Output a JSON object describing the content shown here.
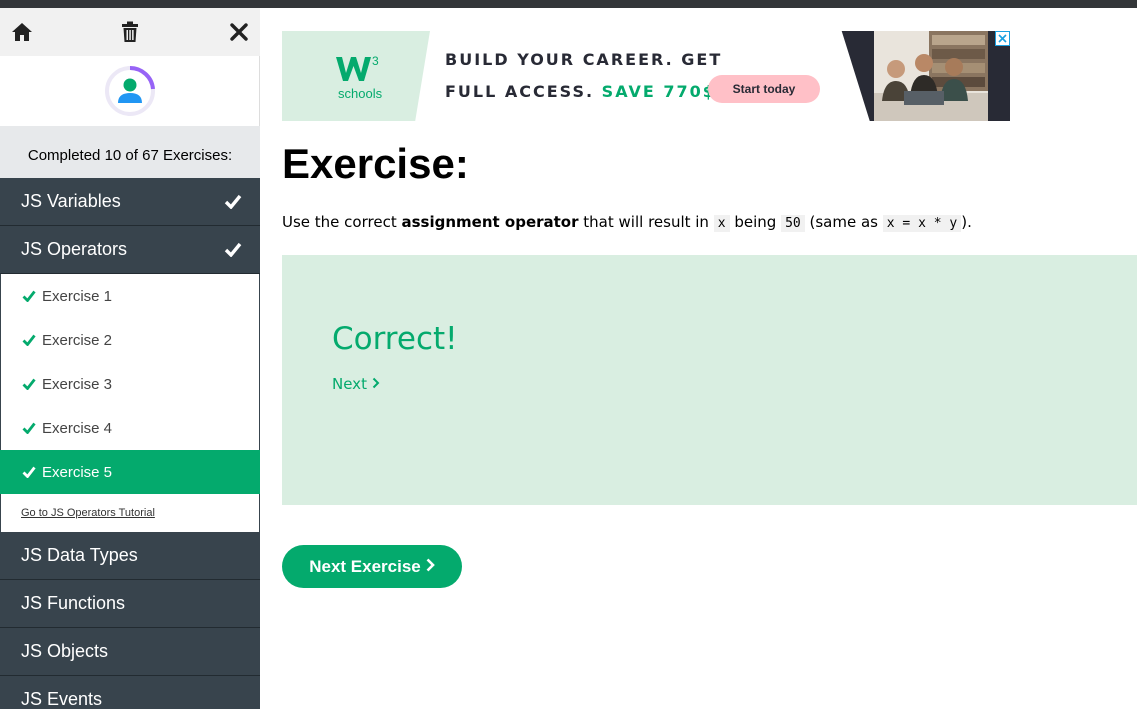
{
  "sidebar": {
    "toolbar": {
      "home_icon": "home-icon",
      "trash_icon": "trash-icon",
      "close_icon": "close-icon"
    },
    "progress_text": "Completed 10 of 67 Exercises:",
    "categories_top": [
      {
        "label": "JS Variables",
        "completed": true
      },
      {
        "label": "JS Operators",
        "completed": true
      }
    ],
    "exercises": [
      {
        "label": "Exercise 1",
        "active": false
      },
      {
        "label": "Exercise 2",
        "active": false
      },
      {
        "label": "Exercise 3",
        "active": false
      },
      {
        "label": "Exercise 4",
        "active": false
      },
      {
        "label": "Exercise 5",
        "active": true
      }
    ],
    "tutorial_link": "Go to JS Operators Tutorial",
    "categories_bottom": [
      {
        "label": "JS Data Types"
      },
      {
        "label": "JS Functions"
      },
      {
        "label": "JS Objects"
      },
      {
        "label": "JS Events"
      }
    ]
  },
  "ad": {
    "logo_text": "schools",
    "line1": "BUILD YOUR CAREER. GET",
    "line2": "FULL ACCESS.",
    "save_text": "SAVE 770$",
    "button": "Start today"
  },
  "main": {
    "title": "Exercise:",
    "instr_prefix": "Use the correct",
    "instr_bold": "assignment operator",
    "instr_mid1": "that will result in",
    "code_x": "x",
    "instr_mid2": "being",
    "code_50": "50",
    "instr_mid3": "(same as",
    "code_expr": "x = x * y",
    "instr_suffix": ").",
    "correct": "Correct!",
    "next_link": "Next",
    "next_button": "Next Exercise"
  },
  "colors": {
    "accent": "#04aa6d",
    "sidebar_dark": "#38444d",
    "result_bg": "#d9eee1"
  }
}
